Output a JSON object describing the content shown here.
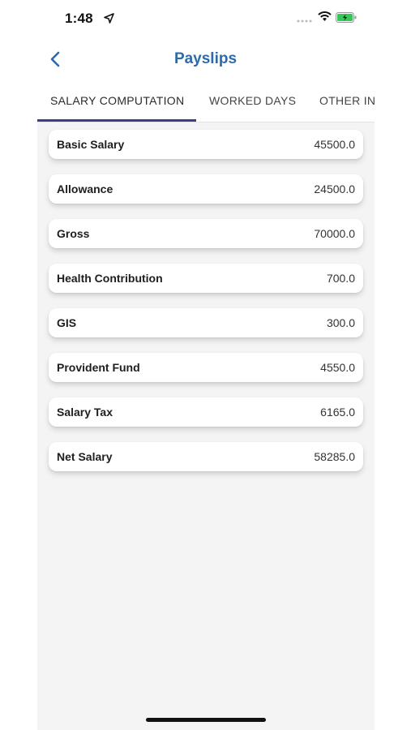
{
  "status_bar": {
    "time": "1:48"
  },
  "header": {
    "title": "Payslips",
    "back_icon": "chevron-left-icon"
  },
  "tabs": [
    {
      "label": "SALARY COMPUTATION",
      "active": true
    },
    {
      "label": "WORKED DAYS",
      "active": false
    },
    {
      "label": "OTHER INPUTS",
      "active": false
    }
  ],
  "salary_rows": [
    {
      "label": "Basic Salary",
      "value": "45500.0"
    },
    {
      "label": "Allowance",
      "value": "24500.0"
    },
    {
      "label": "Gross",
      "value": "70000.0"
    },
    {
      "label": "Health Contribution",
      "value": "700.0"
    },
    {
      "label": "GIS",
      "value": "300.0"
    },
    {
      "label": "Provident Fund",
      "value": "4550.0"
    },
    {
      "label": "Salary Tax",
      "value": "6165.0"
    },
    {
      "label": "Net Salary",
      "value": "58285.0"
    }
  ],
  "colors": {
    "title": "#2d6aa8",
    "tab_indicator": "#3b3f8c",
    "content_bg": "#f4f4f4"
  }
}
